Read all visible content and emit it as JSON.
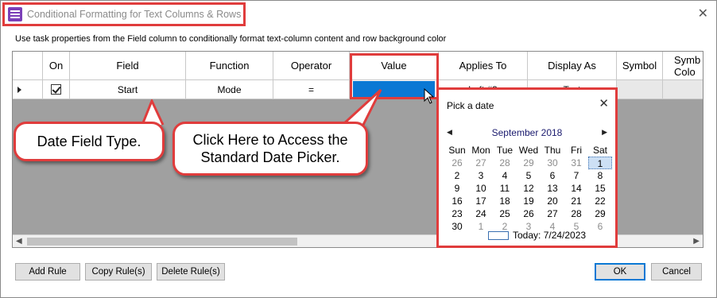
{
  "window": {
    "title": "Conditional Formatting for Text Columns & Rows",
    "close_icon": "close-icon"
  },
  "subtitle": "Use task properties from the Field column to conditionally format text-column content and row background color",
  "grid": {
    "columns": [
      "On",
      "Field",
      "Function",
      "Operator",
      "Value",
      "Applies To",
      "Display As",
      "Symbol",
      "Symb Colo"
    ],
    "row": {
      "on_checked": true,
      "field": "Start",
      "function": "Mode",
      "operator": "=",
      "value": "",
      "applies_to": "Left #3",
      "display_as": "Text"
    }
  },
  "callouts": {
    "left": "Date Field Type.",
    "right_line1": "Click Here to Access the",
    "right_line2": "Standard Date Picker."
  },
  "datepicker": {
    "title": "Pick a date",
    "month_label": "September 2018",
    "weekdays": [
      "Sun",
      "Mon",
      "Tue",
      "Wed",
      "Thu",
      "Fri",
      "Sat"
    ],
    "weeks": [
      [
        {
          "d": "26",
          "m": true
        },
        {
          "d": "27",
          "m": true
        },
        {
          "d": "28",
          "m": true
        },
        {
          "d": "29",
          "m": true
        },
        {
          "d": "30",
          "m": true
        },
        {
          "d": "31",
          "m": true
        },
        {
          "d": "1",
          "s": true
        }
      ],
      [
        {
          "d": "2"
        },
        {
          "d": "3"
        },
        {
          "d": "4"
        },
        {
          "d": "5"
        },
        {
          "d": "6"
        },
        {
          "d": "7"
        },
        {
          "d": "8"
        }
      ],
      [
        {
          "d": "9"
        },
        {
          "d": "10"
        },
        {
          "d": "11"
        },
        {
          "d": "12"
        },
        {
          "d": "13"
        },
        {
          "d": "14"
        },
        {
          "d": "15"
        }
      ],
      [
        {
          "d": "16"
        },
        {
          "d": "17"
        },
        {
          "d": "18"
        },
        {
          "d": "19"
        },
        {
          "d": "20"
        },
        {
          "d": "21"
        },
        {
          "d": "22"
        }
      ],
      [
        {
          "d": "23"
        },
        {
          "d": "24"
        },
        {
          "d": "25"
        },
        {
          "d": "26"
        },
        {
          "d": "27"
        },
        {
          "d": "28"
        },
        {
          "d": "29"
        }
      ],
      [
        {
          "d": "30"
        },
        {
          "d": "1",
          "m": true
        },
        {
          "d": "2",
          "m": true
        },
        {
          "d": "3",
          "m": true
        },
        {
          "d": "4",
          "m": true
        },
        {
          "d": "5",
          "m": true
        },
        {
          "d": "6",
          "m": true
        }
      ]
    ],
    "today_label": "Today: 7/24/2023"
  },
  "buttons": {
    "add_rule": "Add Rule",
    "copy_rule": "Copy Rule(s)",
    "delete_rule": "Delete Rule(s)",
    "ok": "OK",
    "cancel": "Cancel"
  },
  "colors": {
    "highlight_red": "#e03c3c",
    "selection_blue": "#0a78d4"
  }
}
